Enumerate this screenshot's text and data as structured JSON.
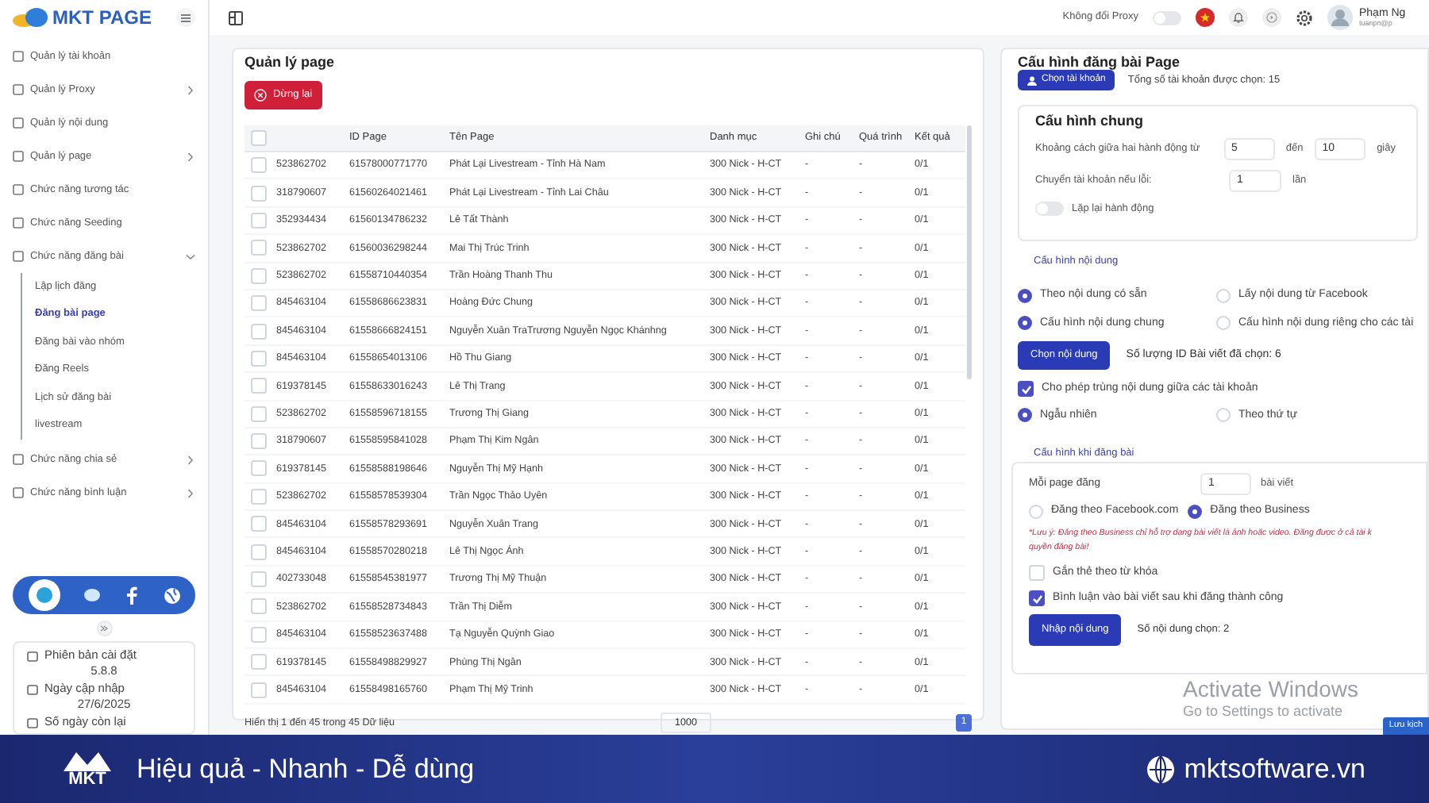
{
  "sidebar": {
    "logo": "MKT PAGE",
    "items": [
      {
        "label": "Quản lý tài khoản",
        "kind": "link"
      },
      {
        "label": "Quản lý Proxy",
        "kind": "group",
        "expanded": false
      },
      {
        "label": "Quản lý nội dung",
        "kind": "link"
      },
      {
        "label": "Quản lý page",
        "kind": "group",
        "expanded": false
      },
      {
        "label": "Chức năng tương tác",
        "kind": "link"
      },
      {
        "label": "Chức năng Seeding",
        "kind": "link"
      },
      {
        "label": "Chức năng đăng bài",
        "kind": "group",
        "expanded": true,
        "children": [
          {
            "label": "Lập lịch đăng",
            "selected": false
          },
          {
            "label": "Đăng bài page",
            "selected": true
          },
          {
            "label": "Đăng bài vào nhóm",
            "selected": false
          },
          {
            "label": "Đăng Reels",
            "selected": false
          },
          {
            "label": "Lịch sử đăng bài",
            "selected": false
          },
          {
            "label": "livestream",
            "selected": false
          }
        ]
      },
      {
        "label": "Chức năng chia sẻ",
        "kind": "group",
        "expanded": false
      },
      {
        "label": "Chức năng bình luận",
        "kind": "group",
        "expanded": false
      }
    ],
    "info": [
      {
        "label": "Phiên bản cài đặt",
        "value": "5.8.8"
      },
      {
        "label": "Ngày cập nhập",
        "value": "27/6/2025"
      },
      {
        "label": "Số ngày còn lại"
      }
    ]
  },
  "top_bar": {
    "proxy_toggle": {
      "label": "Không đổi Proxy",
      "on": false
    },
    "user": {
      "name": "Phạm Ng",
      "email": "tuanpn@p"
    }
  },
  "page_manager": {
    "title": "Quản lý page",
    "stop_button": "Dừng lại",
    "all_selected": false,
    "columns": [
      "",
      "ID Page",
      "Tên Page",
      "Danh mục",
      "Ghi chú",
      "Quá trình",
      "Kết quả"
    ],
    "rows": [
      {
        "selected": false,
        "cells": [
          "523862702",
          "61578000771770",
          "Phát Lại Livestream - Tỉnh Hà Nam",
          "300 Nick - H-CT",
          "-",
          "-",
          "0/1"
        ]
      },
      {
        "selected": false,
        "cells": [
          "318790607",
          "61560264021461",
          "Phát Lại Livestream - Tỉnh Lai Châu",
          "300 Nick - H-CT",
          "-",
          "-",
          "0/1"
        ]
      },
      {
        "selected": false,
        "cells": [
          "352934434",
          "61560134786232",
          "Lê Tất Thành",
          "300 Nick - H-CT",
          "-",
          "-",
          "0/1"
        ]
      },
      {
        "selected": false,
        "cells": [
          "523862702",
          "61560036298244",
          "Mai Thị Trúc Trinh",
          "300 Nick - H-CT",
          "-",
          "-",
          "0/1"
        ]
      },
      {
        "selected": false,
        "cells": [
          "523862702",
          "61558710440354",
          "Trần Hoàng Thanh Thu",
          "300 Nick - H-CT",
          "-",
          "-",
          "0/1"
        ]
      },
      {
        "selected": false,
        "cells": [
          "845463104",
          "61558686623831",
          "Hoàng Đức Chung",
          "300 Nick - H-CT",
          "-",
          "-",
          "0/1"
        ]
      },
      {
        "selected": false,
        "cells": [
          "845463104",
          "61558666824151",
          "Nguyễn Xuân TraTrương Nguyễn Ngọc Khánhng",
          "300 Nick - H-CT",
          "-",
          "-",
          "0/1"
        ]
      },
      {
        "selected": false,
        "cells": [
          "845463104",
          "61558654013106",
          "Hồ Thu Giang",
          "300 Nick - H-CT",
          "-",
          "-",
          "0/1"
        ]
      },
      {
        "selected": false,
        "cells": [
          "619378145",
          "61558633016243",
          "Lê Thị Trang",
          "300 Nick - H-CT",
          "-",
          "-",
          "0/1"
        ]
      },
      {
        "selected": false,
        "cells": [
          "523862702",
          "61558596718155",
          "Trương Thị Giang",
          "300 Nick - H-CT",
          "-",
          "-",
          "0/1"
        ]
      },
      {
        "selected": false,
        "cells": [
          "318790607",
          "61558595841028",
          "Phạm Thị Kim Ngân",
          "300 Nick - H-CT",
          "-",
          "-",
          "0/1"
        ]
      },
      {
        "selected": false,
        "cells": [
          "619378145",
          "61558588198646",
          "Nguyễn Thị Mỹ Hạnh",
          "300 Nick - H-CT",
          "-",
          "-",
          "0/1"
        ]
      },
      {
        "selected": false,
        "cells": [
          "523862702",
          "61558578539304",
          "Trần Ngọc Thảo Uyên",
          "300 Nick - H-CT",
          "-",
          "-",
          "0/1"
        ]
      },
      {
        "selected": false,
        "cells": [
          "845463104",
          "61558578293691",
          "Nguyễn Xuân Trang",
          "300 Nick - H-CT",
          "-",
          "-",
          "0/1"
        ]
      },
      {
        "selected": false,
        "cells": [
          "845463104",
          "61558570280218",
          "Lê Thị Ngọc Ánh",
          "300 Nick - H-CT",
          "-",
          "-",
          "0/1"
        ]
      },
      {
        "selected": false,
        "cells": [
          "402733048",
          "61558545381977",
          "Trương Thị Mỹ Thuận",
          "300 Nick - H-CT",
          "-",
          "-",
          "0/1"
        ]
      },
      {
        "selected": false,
        "cells": [
          "523862702",
          "61558528734843",
          "Trần Thị Diễm",
          "300 Nick - H-CT",
          "-",
          "-",
          "0/1"
        ]
      },
      {
        "selected": false,
        "cells": [
          "845463104",
          "61558523637488",
          "Tạ Nguyễn Quỳnh Giao",
          "300 Nick - H-CT",
          "-",
          "-",
          "0/1"
        ]
      },
      {
        "selected": false,
        "cells": [
          "619378145",
          "61558498829927",
          "Phùng Thị Ngân",
          "300 Nick - H-CT",
          "-",
          "-",
          "0/1"
        ]
      },
      {
        "selected": false,
        "cells": [
          "845463104",
          "61558498165760",
          "Phạm Thị Mỹ Trinh",
          "300 Nick - H-CT",
          "-",
          "-",
          "0/1"
        ]
      }
    ],
    "summary": "Hiển thị 1 đến 45 trong 45 Dữ liệu",
    "page_size": "1000",
    "pages": [
      {
        "label": "1",
        "selected": true
      }
    ]
  },
  "post_config": {
    "title": "Cấu hình đăng bài Page",
    "account_button": "Chọn tài khoản",
    "account_total": "Tổng số tài khoản được chọn: 15",
    "general": {
      "title": "Cấu hình chung",
      "delay_label": "Khoảng cách giữa hai hành động từ",
      "delay_from": "5",
      "delay_to_label": "đến",
      "delay_to": "10",
      "delay_unit": "giây",
      "switch_label": "Chuyển tài khoản nếu lỗi:",
      "switch_value": "1",
      "switch_unit": "lần",
      "repeat": {
        "label": "Lặp lại hành động",
        "on": false
      }
    },
    "content": {
      "title": "Cấu hình nội dung",
      "source_options": [
        {
          "label": "Theo nội dung có sẵn",
          "selected": true
        },
        {
          "label": "Lấy nội dung từ Facebook",
          "selected": false
        }
      ],
      "scope_options": [
        {
          "label": "Cấu hình nội dung chung",
          "selected": true
        },
        {
          "label": "Cấu hình nội dung riêng cho các tài",
          "selected": false
        }
      ],
      "choose_button": "Chọn nội dung",
      "chosen_count": "Số lượng ID Bài viết đã chọn: 6",
      "allow_duplicate": {
        "label": "Cho phép trùng nội dung giữa các tài khoản",
        "checked": true
      },
      "order_options": [
        {
          "label": "Ngẫu nhiên",
          "selected": true
        },
        {
          "label": "Theo thứ tự",
          "selected": false
        }
      ]
    },
    "posting": {
      "title": "Cấu hình khi đăng bài",
      "per_page_label": "Mỗi page đăng",
      "per_page_value": "1",
      "per_page_unit": "bài viết",
      "mode_options": [
        {
          "label": "Đăng theo Facebook.com",
          "selected": false
        },
        {
          "label": "Đăng theo Business",
          "selected": true
        }
      ],
      "note_lines": [
        "*Lưu ý: Đăng theo Business chỉ hỗ trợ dạng bài viết là ảnh hoặc video. Đăng được ở cả tài k",
        "quyền đăng bài!"
      ],
      "checks": [
        {
          "label": "Gắn thẻ theo từ khóa",
          "checked": false
        },
        {
          "label": "Bình luận vào bài viết sau khi đăng thành công",
          "checked": true
        }
      ],
      "import_button": "Nhập nội dung",
      "import_count": "Số nội dung chọn: 2"
    }
  },
  "windows_notice": {
    "title": "Activate Windows",
    "subtitle": "Go to Settings to activate",
    "button": "Lưu kịch"
  },
  "banner": {
    "logo": "MKT",
    "slogan": "Hiệu quả - Nhanh - Dễ dùng",
    "website": "mktsoftware.vn"
  }
}
